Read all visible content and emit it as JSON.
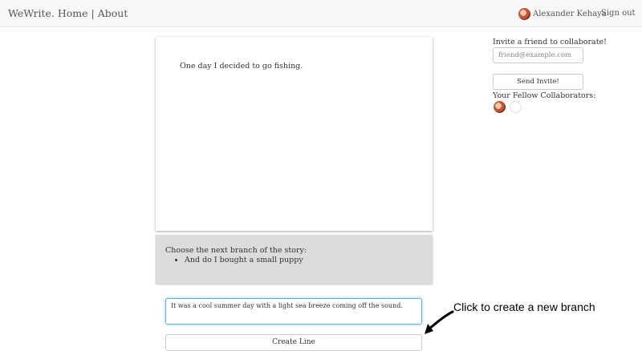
{
  "navbar": {
    "brand": "WeWrite.",
    "home_link": "Home",
    "separator": "|",
    "about_link": "About",
    "user_name": "Alexander Kehaya",
    "sign_out": "Sign out"
  },
  "story": {
    "lines": [
      "One day I decided to go fishing."
    ]
  },
  "branches": {
    "title": "Choose the next branch of the story:",
    "items": [
      "And do I bought a small puppy"
    ]
  },
  "composer": {
    "input_value": "It was a cool summer day with a light sea breeze coming off the sound.",
    "create_label": "Create Line"
  },
  "sidebar": {
    "invite_label": "Invite a friend to collaborate!",
    "email_placeholder": "friend@example.com",
    "invite_button": "Send Invite!",
    "collaborators_label": "Your Fellow Collaborators:"
  },
  "annotation": {
    "text": "Click to create a new branch"
  }
}
